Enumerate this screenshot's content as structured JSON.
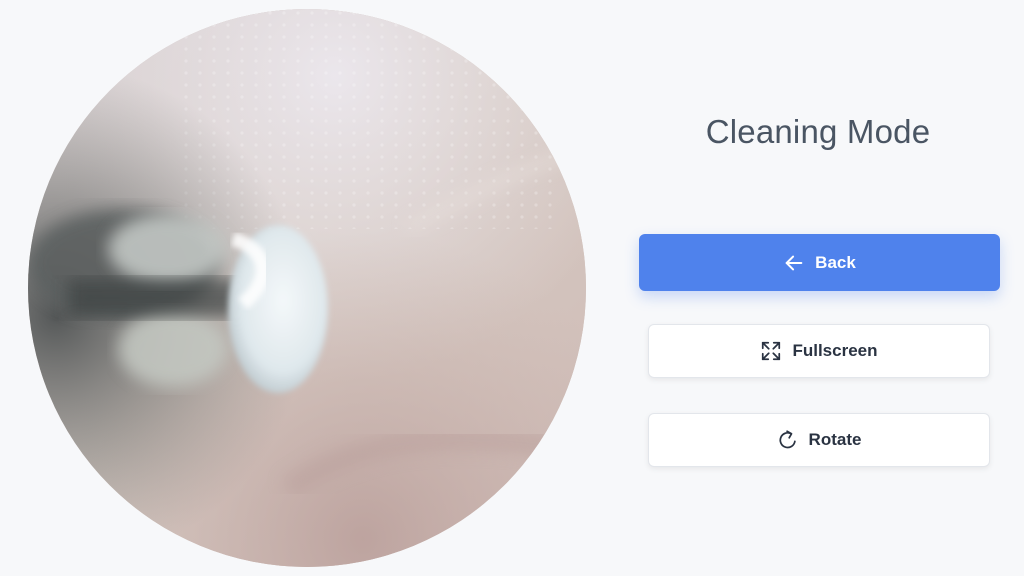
{
  "panel": {
    "title": "Cleaning Mode"
  },
  "buttons": {
    "back": {
      "label": "Back",
      "icon": "arrow-left-icon",
      "color": "#4f82ec"
    },
    "fullscreen": {
      "label": "Fullscreen",
      "icon": "expand-arrows-icon"
    },
    "rotate": {
      "label": "Rotate",
      "icon": "rotate-icon"
    }
  },
  "camera": {
    "shape": "circle"
  }
}
